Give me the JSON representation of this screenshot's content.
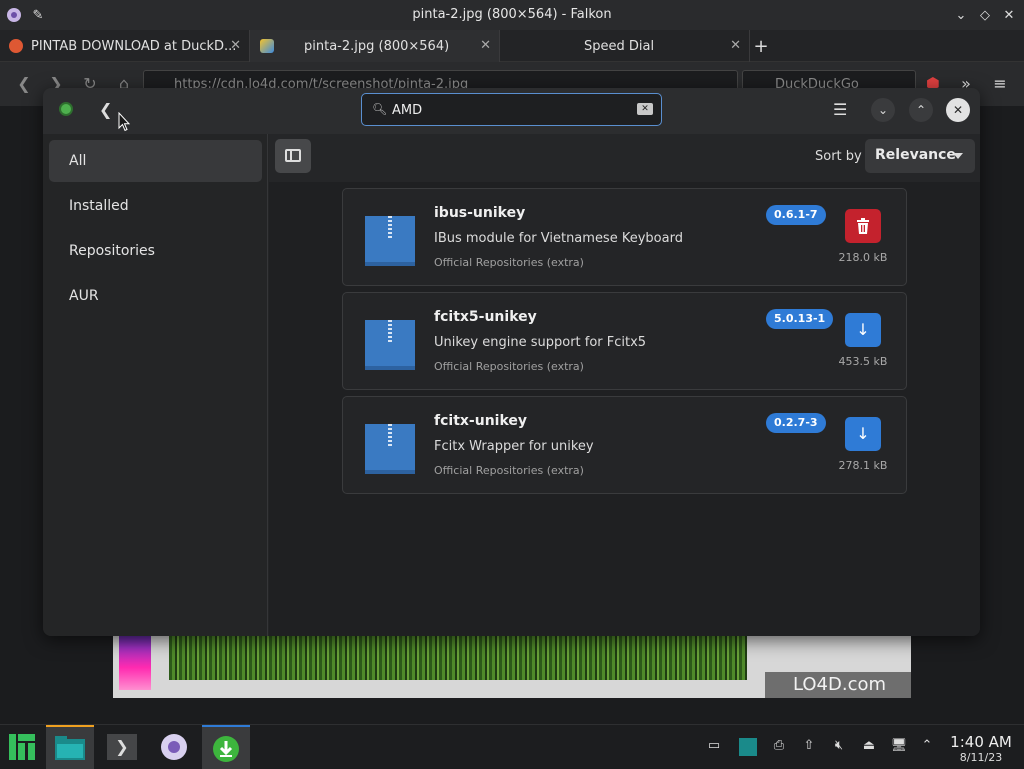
{
  "window": {
    "title": "pinta-2.jpg (800×564) - Falkon"
  },
  "tabs": [
    {
      "label": "PINTAB DOWNLOAD at DuckD...",
      "close": "✕"
    },
    {
      "label": "pinta-2.jpg (800×564)",
      "close": "✕"
    },
    {
      "label": "Speed Dial",
      "close": "✕"
    }
  ],
  "navbar": {
    "url": "https://cdn.lo4d.com/t/screenshot/pinta-2.jpg",
    "search_placeholder": "DuckDuckGo"
  },
  "app": {
    "search_value": "AMD",
    "sort_label": "Sort by",
    "sort_value": "Relevance"
  },
  "sidebar": {
    "items": [
      {
        "label": "All"
      },
      {
        "label": "Installed"
      },
      {
        "label": "Repositories"
      },
      {
        "label": "AUR"
      }
    ]
  },
  "packages": [
    {
      "name": "ibus-unikey",
      "description": "IBus module for Vietnamese Keyboard",
      "repo": "Official Repositories (extra)",
      "version": "0.6.1-7",
      "size": "218.0 kB",
      "action": "remove"
    },
    {
      "name": "fcitx5-unikey",
      "description": "Unikey engine support for Fcitx5",
      "repo": "Official Repositories (extra)",
      "version": "5.0.13-1",
      "size": "453.5 kB",
      "action": "install"
    },
    {
      "name": "fcitx-unikey",
      "description": "Fcitx Wrapper for unikey",
      "repo": "Official Repositories (extra)",
      "version": "0.2.7-3",
      "size": "278.1 kB",
      "action": "install"
    }
  ],
  "watermark": "LO4D.com",
  "taskbar": {
    "time": "1:40 AM",
    "date": "8/11/23"
  },
  "colors": {
    "accent": "#2f7bd6",
    "danger": "#c4222d",
    "background": "#242526"
  }
}
